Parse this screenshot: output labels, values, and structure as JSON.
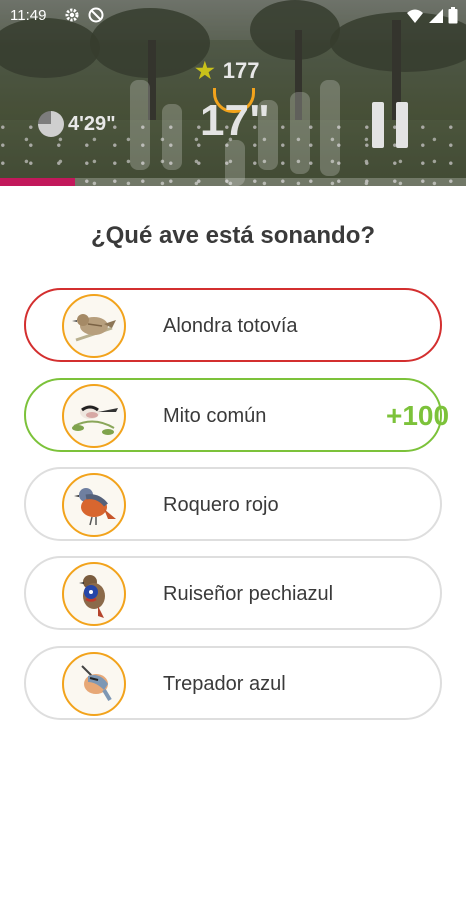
{
  "status_bar": {
    "time": "11:49",
    "left_icons": [
      "gear-icon",
      "blocked-icon"
    ],
    "right_icons": [
      "wifi-icon",
      "signal-icon",
      "battery-icon"
    ]
  },
  "game": {
    "score": "177",
    "elapsed_time": "4'29\"",
    "countdown": "17\"",
    "progress_fraction": 0.16,
    "colors": {
      "progress": "#c2185b",
      "accent": "#f2a31c",
      "star": "#c9c21a",
      "correct": "#7cc23a",
      "wrong": "#d32f2f"
    }
  },
  "question": "¿Qué ave está sonando?",
  "options": [
    {
      "label": "Alondra totovía",
      "state": "wrong"
    },
    {
      "label": "Mito común",
      "state": "correct"
    },
    {
      "label": "Roquero rojo",
      "state": "neutral"
    },
    {
      "label": "Ruiseñor pechiazul",
      "state": "neutral"
    },
    {
      "label": "Trepador azul",
      "state": "neutral"
    }
  ],
  "points_awarded": "+100"
}
